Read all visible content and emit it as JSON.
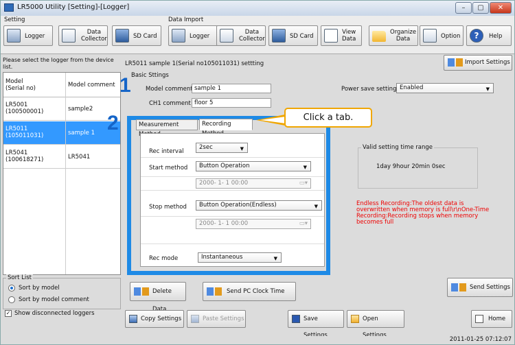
{
  "window": {
    "title": "LR5000 Utility [Setting]-[Logger]",
    "min": "–",
    "max": "▢",
    "close": "✕"
  },
  "toolbar": {
    "setting_group": "Setting",
    "import_group": "Data Import",
    "setting_buttons": [
      {
        "label": "Logger",
        "icon": "logger-icon"
      },
      {
        "label": "Data\nCollector",
        "icon": "data-collector-icon"
      },
      {
        "label": "SD Card",
        "icon": "sd-card-icon"
      }
    ],
    "import_buttons": [
      {
        "label": "Logger",
        "icon": "logger-icon"
      },
      {
        "label": "Data\nCollector",
        "icon": "data-collector-icon"
      },
      {
        "label": "SD Card",
        "icon": "sd-card-icon"
      }
    ],
    "view_data": "View\nData",
    "organize_data": "Organize\nData",
    "option": "Option",
    "help": "Help"
  },
  "device_panel": {
    "prompt": "Please select the logger from the device list.",
    "col_model": "Model\n(Serial no)",
    "col_comment": "Model comment",
    "devices": [
      {
        "model": "LR5001\n(100500001)",
        "comment": "sample2",
        "selected": false
      },
      {
        "model": "LR5011\n(105011031)",
        "comment": "sample 1",
        "selected": true
      },
      {
        "model": "LR5041\n(100618271)",
        "comment": "LR5041",
        "selected": false
      }
    ]
  },
  "sort": {
    "title": "Sort List",
    "by_model": "Sort by model",
    "by_comment": "Sort by model comment",
    "show_disconnected": "Show disconnected loggers"
  },
  "settings": {
    "header": "LR5011 sample 1(Serial no105011031) settting",
    "import_settings": "Import Settings",
    "basic_label": "Basic Sttings",
    "model_comment_label": "Model comment",
    "model_comment": "sample 1",
    "ch1_comment_label": "CH1 comment",
    "ch1_comment": "floor 5",
    "power_save_label": "Power save setting",
    "power_save": "Enabled"
  },
  "tabs": {
    "measurement": "Measurement Method",
    "recording": "Recording Method"
  },
  "recording": {
    "rec_interval_label": "Rec interval",
    "rec_interval": "2sec",
    "start_method_label": "Start method",
    "start_method": "Button Operation",
    "start_date": "2000- 1- 1 00:00",
    "stop_method_label": "Stop method",
    "stop_method": "Button Operation(Endless)",
    "stop_date": "2000- 1- 1 00:00",
    "rec_mode_label": "Rec mode",
    "rec_mode": "Instantaneous"
  },
  "valid_range": {
    "title": "Valid setting time range",
    "value": "1day 9hour 20min 0sec"
  },
  "note": "Endless Recording:The oldest data is overwritten when memory is full\\r\\nOne-Time Recording:Recording stops when memory becomes full",
  "callout": "Click a tab.",
  "steps": {
    "one": "1",
    "two": "2"
  },
  "buttons": {
    "delete_data": "Delete Data",
    "send_clock": "Send PC Clock Time",
    "send_settings": "Send Settings",
    "copy_settings": "Copy Settings",
    "paste_settings": "Paste Settings",
    "save_settings": "Save Settings",
    "open_settings": "Open Settings",
    "home": "Home"
  },
  "status": {
    "timestamp": "2011-01-25 07:12:07"
  },
  "colors": {
    "highlight": "#1e8ae6",
    "selection": "#3399ff",
    "callout_border": "#f0a600",
    "note": "#e00000",
    "step_number": "#1565c8"
  }
}
